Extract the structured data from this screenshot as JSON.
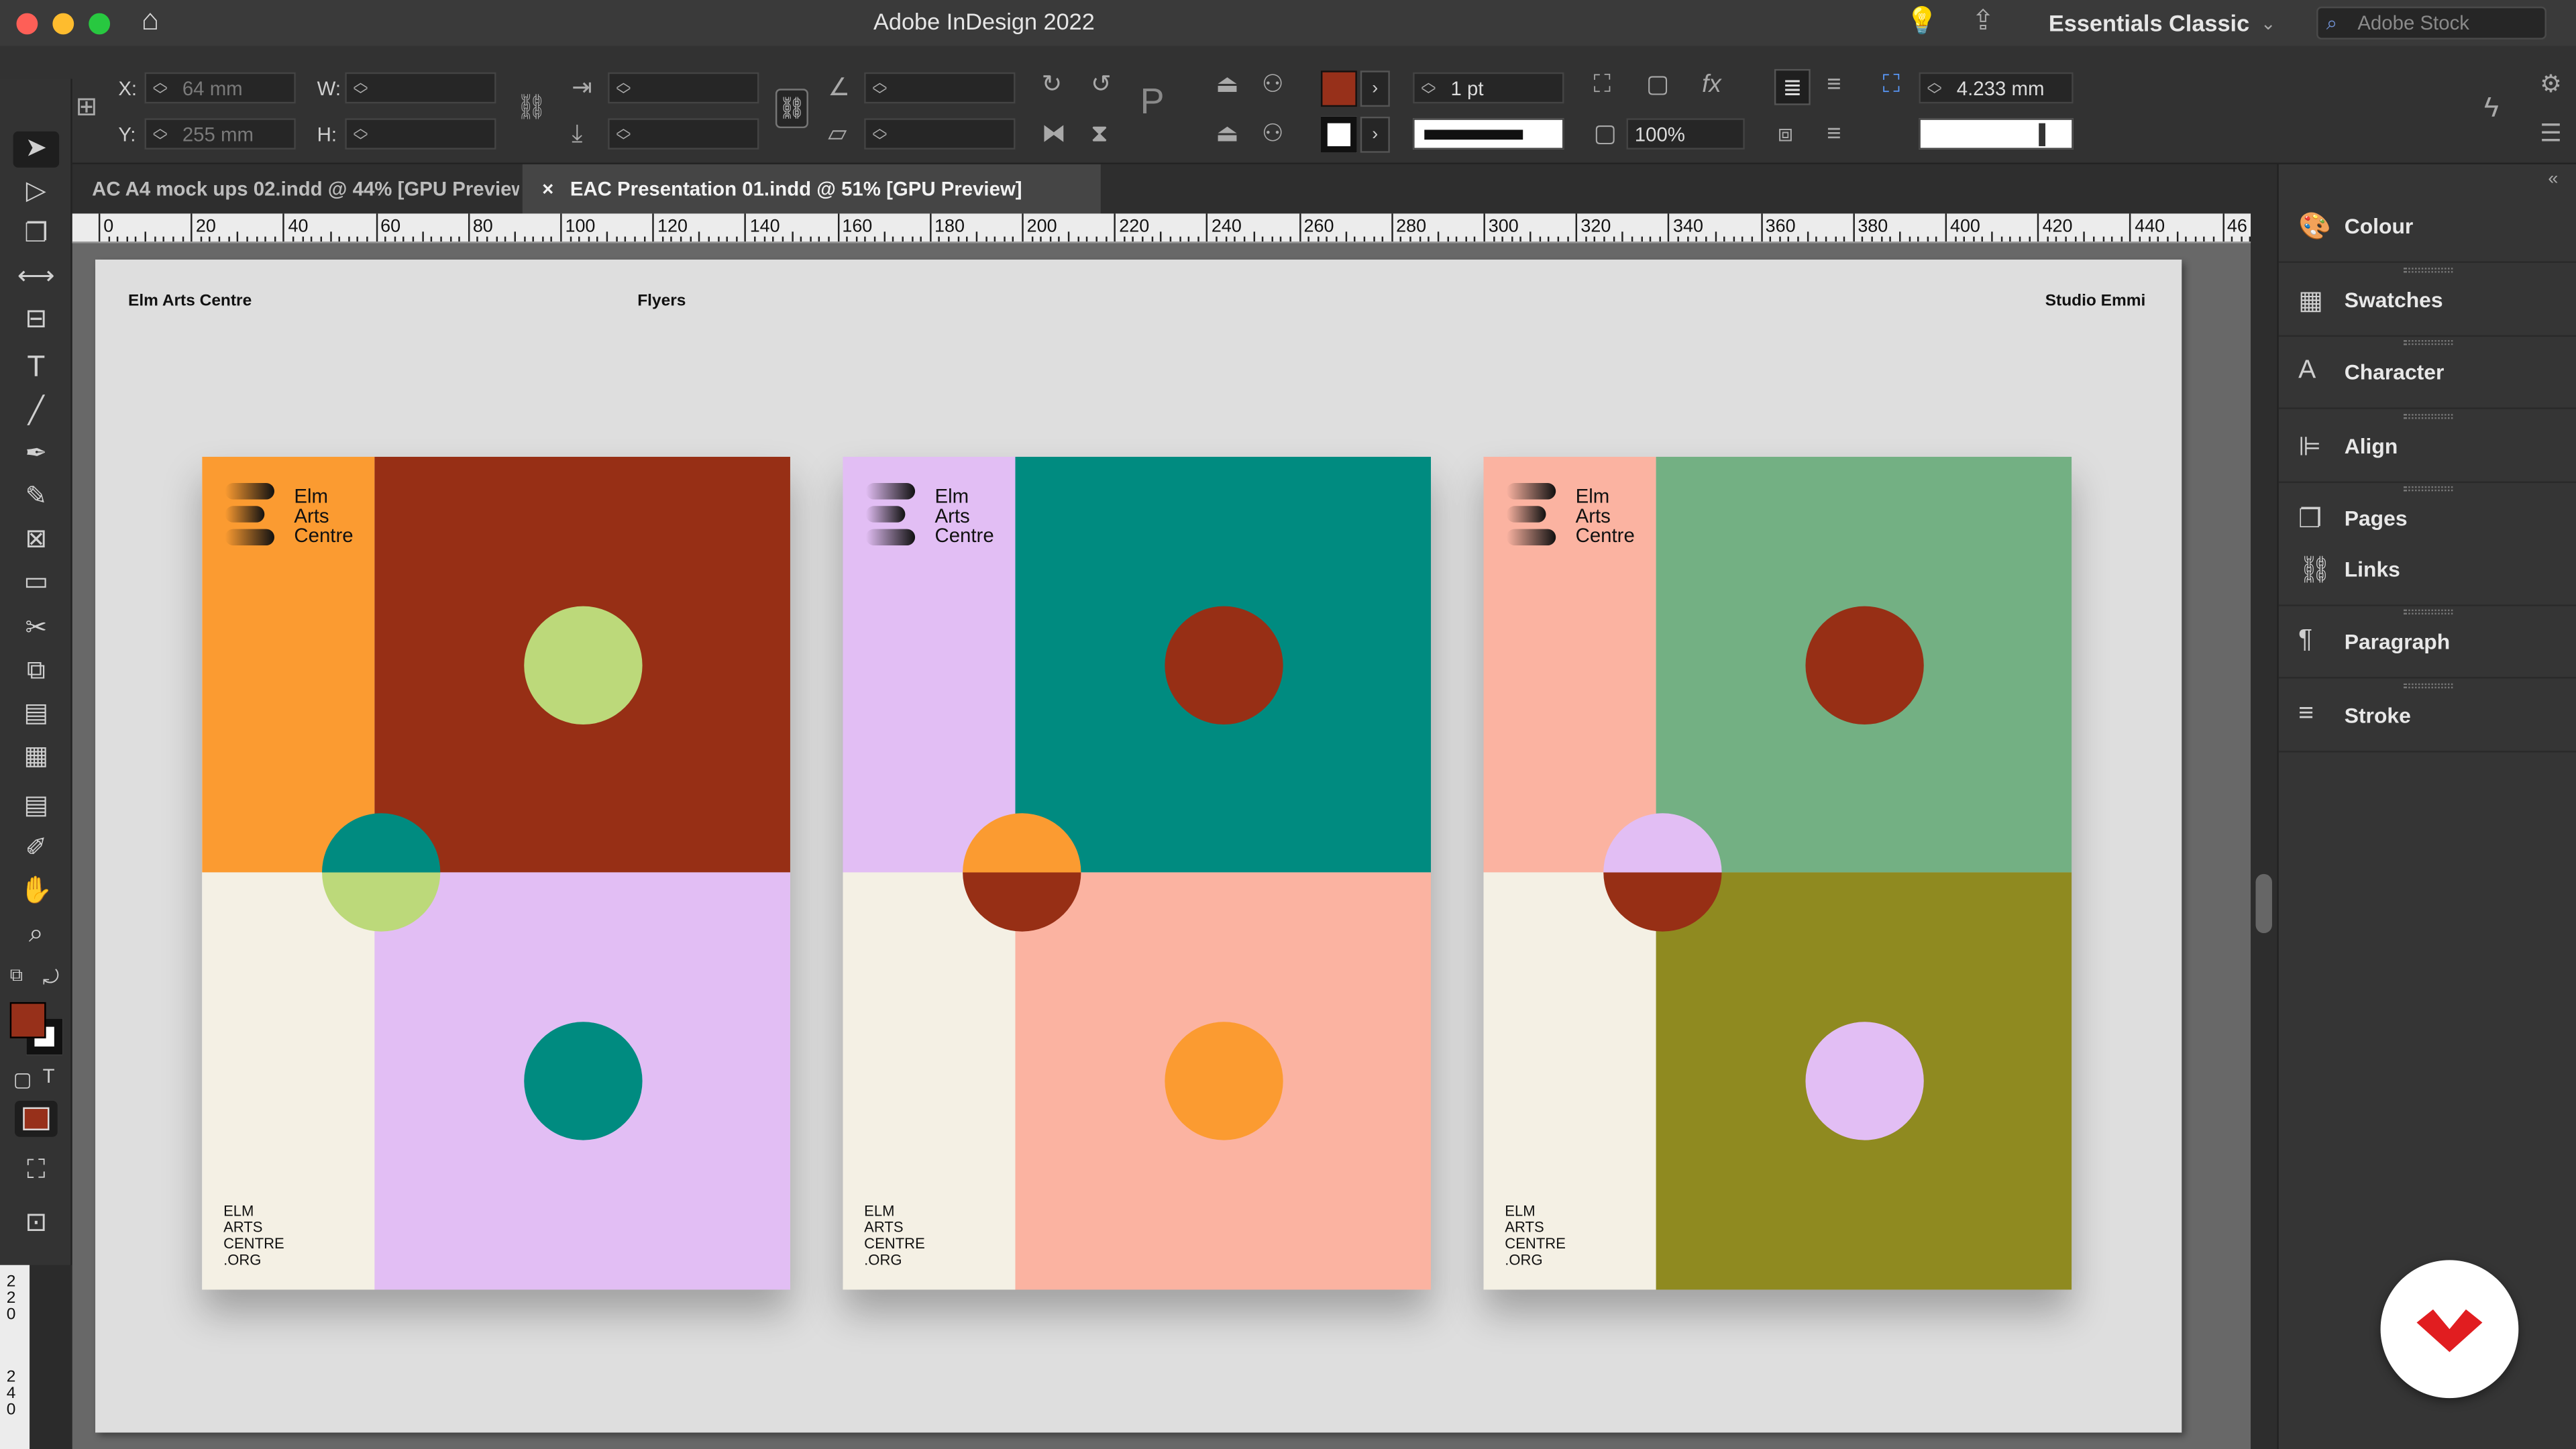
{
  "app": {
    "title": "Adobe InDesign 2022",
    "workspace": "Essentials Classic",
    "stock_search_placeholder": "Adobe Stock"
  },
  "control": {
    "x_label": "X:",
    "x_value": "64 mm",
    "y_label": "Y:",
    "y_value": "255 mm",
    "w_label": "W:",
    "h_label": "H:",
    "stroke_weight": "1 pt",
    "opacity": "100%",
    "offset": "4.233 mm",
    "fill_color": "#97301a",
    "stroke_color": "#111111"
  },
  "tabs": [
    {
      "label": "AC A4 mock ups 02.indd @ 44% [GPU Preview]",
      "active": false
    },
    {
      "label": "EAC Presentation 01.indd @ 51% [GPU Preview]",
      "active": true,
      "close": "×"
    }
  ],
  "ruler": {
    "ticks": [
      "0",
      "20",
      "40",
      "60",
      "80",
      "100",
      "120",
      "140",
      "160",
      "180",
      "200",
      "220",
      "240",
      "260",
      "280",
      "300",
      "320",
      "340",
      "360",
      "380",
      "400",
      "420",
      "440",
      "46"
    ],
    "vertical": [
      "220",
      "240"
    ]
  },
  "page": {
    "header_left": "Elm Arts Centre",
    "header_center": "Flyers",
    "header_right": "Studio Emmi"
  },
  "flyers": [
    {
      "logo": [
        "Elm",
        "Arts",
        "Centre"
      ],
      "footer": [
        "ELM",
        "ARTS",
        "CENTRE",
        ".ORG"
      ],
      "colors": {
        "tl": "#fb9b31",
        "tr": "#972f15",
        "bl": "#f4f0e4",
        "br": "#e2bef4",
        "c_top": "#bcd97a",
        "c_mid_top": "#008b80",
        "c_mid_bottom": "#bcd97a",
        "c_bottom": "#008b80"
      }
    },
    {
      "logo": [
        "Elm",
        "Arts",
        "Centre"
      ],
      "footer": [
        "ELM",
        "ARTS",
        "CENTRE",
        ".ORG"
      ],
      "colors": {
        "tl": "#e2bef4",
        "tr": "#008b80",
        "bl": "#f4f0e4",
        "br": "#fbb3a1",
        "c_top": "#972f15",
        "c_mid_top": "#fb9b31",
        "c_mid_bottom": "#972f15",
        "c_bottom": "#fb9b31"
      }
    },
    {
      "logo": [
        "Elm",
        "Arts",
        "Centre"
      ],
      "footer": [
        "ELM",
        "ARTS",
        "CENTRE",
        ".ORG"
      ],
      "colors": {
        "tl": "#fbb3a1",
        "tr": "#73b083",
        "bl": "#f4f0e4",
        "br": "#8f8a20",
        "c_top": "#972f15",
        "c_mid_top": "#e2bef4",
        "c_mid_bottom": "#972f15",
        "c_bottom": "#e2bef4"
      }
    }
  ],
  "panels": [
    {
      "label": "Colour",
      "icon": "palette-icon",
      "glyph": "🎨"
    },
    {
      "label": "Swatches",
      "icon": "swatches-icon",
      "glyph": "▦"
    },
    {
      "label": "Character",
      "icon": "character-icon",
      "glyph": "A"
    },
    {
      "label": "Align",
      "icon": "align-icon",
      "glyph": "⊫"
    },
    {
      "label": "Pages",
      "icon": "pages-icon",
      "glyph": "❐"
    },
    {
      "label": "Links",
      "icon": "links-icon",
      "glyph": "⛓"
    },
    {
      "label": "Paragraph",
      "icon": "paragraph-icon",
      "glyph": "¶"
    },
    {
      "label": "Stroke",
      "icon": "stroke-icon",
      "glyph": "≡"
    }
  ]
}
